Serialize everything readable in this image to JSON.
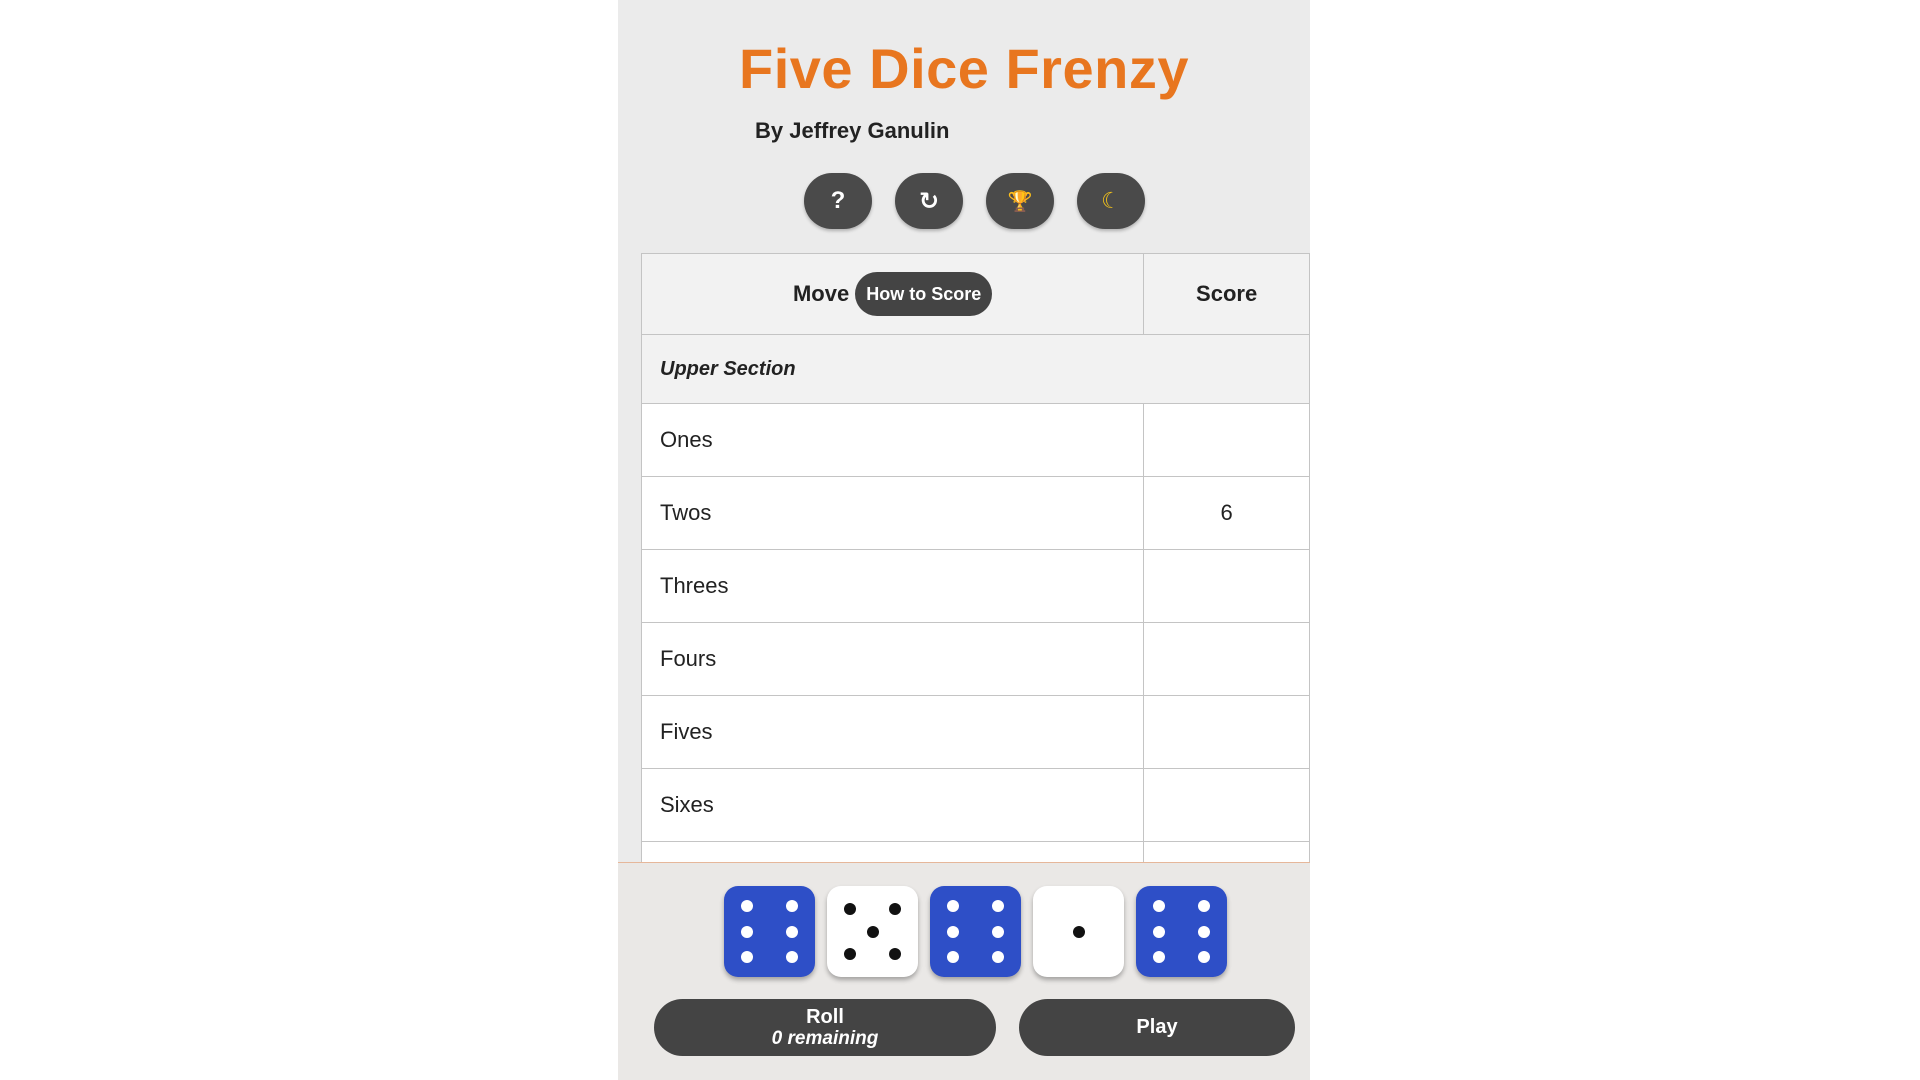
{
  "app": {
    "title": "Five Dice Frenzy",
    "author": "By Jeffrey Ganulin",
    "accent_color": "#e8761f"
  },
  "toolbar": [
    {
      "name": "help-icon",
      "glyph": "?"
    },
    {
      "name": "restart-icon",
      "glyph": "↻"
    },
    {
      "name": "trophy-icon",
      "glyph": "🏆"
    },
    {
      "name": "moon-icon",
      "glyph": "☾"
    }
  ],
  "table": {
    "header_move": "Move",
    "how_to_score": "How to Score",
    "header_score": "Score",
    "section_upper": "Upper Section",
    "rows": [
      {
        "name": "Ones",
        "score": ""
      },
      {
        "name": "Twos",
        "score": "6"
      },
      {
        "name": "Threes",
        "score": ""
      },
      {
        "name": "Fours",
        "score": ""
      },
      {
        "name": "Fives",
        "score": ""
      },
      {
        "name": "Sixes",
        "score": ""
      }
    ]
  },
  "dice": [
    {
      "value": 6,
      "held": true
    },
    {
      "value": 5,
      "held": false
    },
    {
      "value": 6,
      "held": true
    },
    {
      "value": 1,
      "held": false
    },
    {
      "value": 6,
      "held": true
    }
  ],
  "controls": {
    "roll_label": "Roll",
    "roll_remaining": "0 remaining",
    "play_label": "Play"
  },
  "colors": {
    "held_die": "#2e4fc7",
    "button": "#444444"
  }
}
